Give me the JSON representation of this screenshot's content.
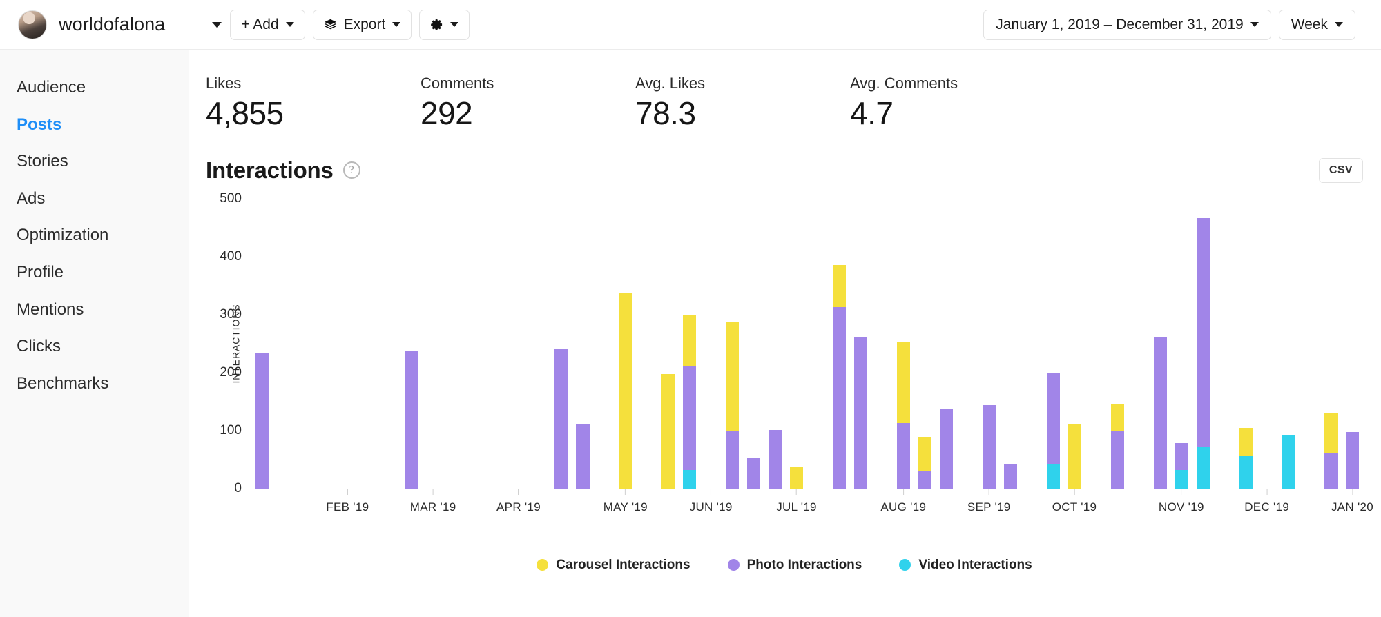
{
  "header": {
    "username": "worldofalona",
    "account_caret_icon": "chevron-down-icon",
    "add_label": "+ Add",
    "export_label": "Export",
    "export_icon": "layers-icon",
    "settings_icon": "gear-icon",
    "date_range": "January 1, 2019 – December 31, 2019",
    "granularity": "Week"
  },
  "sidebar": {
    "items": [
      {
        "label": "Audience",
        "active": false
      },
      {
        "label": "Posts",
        "active": true
      },
      {
        "label": "Stories",
        "active": false
      },
      {
        "label": "Ads",
        "active": false
      },
      {
        "label": "Optimization",
        "active": false
      },
      {
        "label": "Profile",
        "active": false
      },
      {
        "label": "Mentions",
        "active": false
      },
      {
        "label": "Clicks",
        "active": false
      },
      {
        "label": "Benchmarks",
        "active": false
      }
    ],
    "active_color": "#1e8ef7"
  },
  "kpis": [
    {
      "label": "Likes",
      "value": "4,855"
    },
    {
      "label": "Comments",
      "value": "292"
    },
    {
      "label": "Avg. Likes",
      "value": "78.3"
    },
    {
      "label": "Avg. Comments",
      "value": "4.7"
    }
  ],
  "chart_panel": {
    "title": "Interactions",
    "help_icon": "question-mark-icon",
    "help_glyph": "?",
    "csv_label": "CSV"
  },
  "chart_data": {
    "type": "bar",
    "stacked": true,
    "title": "Interactions",
    "xlabel": "",
    "ylabel": "INTERACTIONS",
    "ylim": [
      0,
      500
    ],
    "yticks": [
      0,
      100,
      200,
      300,
      400,
      500
    ],
    "grid": true,
    "legend_position": "bottom",
    "colors": {
      "carousel": "#f5e03c",
      "photo": "#a185e8",
      "video": "#2fd2ec"
    },
    "legend": [
      {
        "name": "Carousel Interactions",
        "color": "#f5e03c"
      },
      {
        "name": "Photo Interactions",
        "color": "#a185e8"
      },
      {
        "name": "Video Interactions",
        "color": "#2fd2ec"
      }
    ],
    "month_ticks": [
      {
        "label": "FEB '19",
        "week_index": 4
      },
      {
        "label": "MAR '19",
        "week_index": 8
      },
      {
        "label": "APR '19",
        "week_index": 12
      },
      {
        "label": "MAY '19",
        "week_index": 17
      },
      {
        "label": "JUN '19",
        "week_index": 21
      },
      {
        "label": "JUL '19",
        "week_index": 25
      },
      {
        "label": "AUG '19",
        "week_index": 30
      },
      {
        "label": "SEP '19",
        "week_index": 34
      },
      {
        "label": "OCT '19",
        "week_index": 38
      },
      {
        "label": "NOV '19",
        "week_index": 43
      },
      {
        "label": "DEC '19",
        "week_index": 47
      },
      {
        "label": "JAN '20",
        "week_index": 51
      }
    ],
    "series": [
      {
        "name": "Carousel Interactions",
        "key": "carousel",
        "color": "#f5e03c"
      },
      {
        "name": "Photo Interactions",
        "key": "photo",
        "color": "#a185e8"
      },
      {
        "name": "Video Interactions",
        "key": "video",
        "color": "#2fd2ec"
      }
    ],
    "weeks": [
      {
        "carousel": 0,
        "photo": 233,
        "video": 0
      },
      {
        "carousel": 0,
        "photo": 0,
        "video": 0
      },
      {
        "carousel": 0,
        "photo": 0,
        "video": 0
      },
      {
        "carousel": 0,
        "photo": 0,
        "video": 0
      },
      {
        "carousel": 0,
        "photo": 0,
        "video": 0
      },
      {
        "carousel": 0,
        "photo": 0,
        "video": 0
      },
      {
        "carousel": 0,
        "photo": 0,
        "video": 0
      },
      {
        "carousel": 0,
        "photo": 238,
        "video": 0
      },
      {
        "carousel": 0,
        "photo": 0,
        "video": 0
      },
      {
        "carousel": 0,
        "photo": 0,
        "video": 0
      },
      {
        "carousel": 0,
        "photo": 0,
        "video": 0
      },
      {
        "carousel": 0,
        "photo": 0,
        "video": 0
      },
      {
        "carousel": 0,
        "photo": 0,
        "video": 0
      },
      {
        "carousel": 0,
        "photo": 0,
        "video": 0
      },
      {
        "carousel": 0,
        "photo": 241,
        "video": 0
      },
      {
        "carousel": 0,
        "photo": 111,
        "video": 0
      },
      {
        "carousel": 0,
        "photo": 0,
        "video": 0
      },
      {
        "carousel": 338,
        "photo": 0,
        "video": 0
      },
      {
        "carousel": 0,
        "photo": 0,
        "video": 0
      },
      {
        "carousel": 197,
        "photo": 0,
        "video": 0
      },
      {
        "carousel": 87,
        "photo": 180,
        "video": 31
      },
      {
        "carousel": 0,
        "photo": 0,
        "video": 0
      },
      {
        "carousel": 188,
        "photo": 100,
        "video": 0
      },
      {
        "carousel": 0,
        "photo": 52,
        "video": 0
      },
      {
        "carousel": 0,
        "photo": 101,
        "video": 0
      },
      {
        "carousel": 38,
        "photo": 0,
        "video": 0
      },
      {
        "carousel": 0,
        "photo": 0,
        "video": 0
      },
      {
        "carousel": 73,
        "photo": 312,
        "video": 0
      },
      {
        "carousel": 0,
        "photo": 261,
        "video": 0
      },
      {
        "carousel": 0,
        "photo": 0,
        "video": 0
      },
      {
        "carousel": 139,
        "photo": 113,
        "video": 0
      },
      {
        "carousel": 60,
        "photo": 29,
        "video": 0
      },
      {
        "carousel": 0,
        "photo": 137,
        "video": 0
      },
      {
        "carousel": 0,
        "photo": 0,
        "video": 0
      },
      {
        "carousel": 0,
        "photo": 143,
        "video": 0
      },
      {
        "carousel": 0,
        "photo": 41,
        "video": 0
      },
      {
        "carousel": 0,
        "photo": 0,
        "video": 0
      },
      {
        "carousel": 0,
        "photo": 158,
        "video": 42
      },
      {
        "carousel": 110,
        "photo": 0,
        "video": 0
      },
      {
        "carousel": 0,
        "photo": 0,
        "video": 0
      },
      {
        "carousel": 46,
        "photo": 99,
        "video": 0
      },
      {
        "carousel": 0,
        "photo": 0,
        "video": 0
      },
      {
        "carousel": 0,
        "photo": 261,
        "video": 0
      },
      {
        "carousel": 0,
        "photo": 47,
        "video": 31
      },
      {
        "carousel": 0,
        "photo": 395,
        "video": 71
      },
      {
        "carousel": 0,
        "photo": 0,
        "video": 0
      },
      {
        "carousel": 47,
        "photo": 0,
        "video": 57
      },
      {
        "carousel": 0,
        "photo": 0,
        "video": 0
      },
      {
        "carousel": 0,
        "photo": 0,
        "video": 91
      },
      {
        "carousel": 0,
        "photo": 0,
        "video": 0
      },
      {
        "carousel": 69,
        "photo": 61,
        "video": 0
      },
      {
        "carousel": 0,
        "photo": 97,
        "video": 0
      }
    ]
  }
}
